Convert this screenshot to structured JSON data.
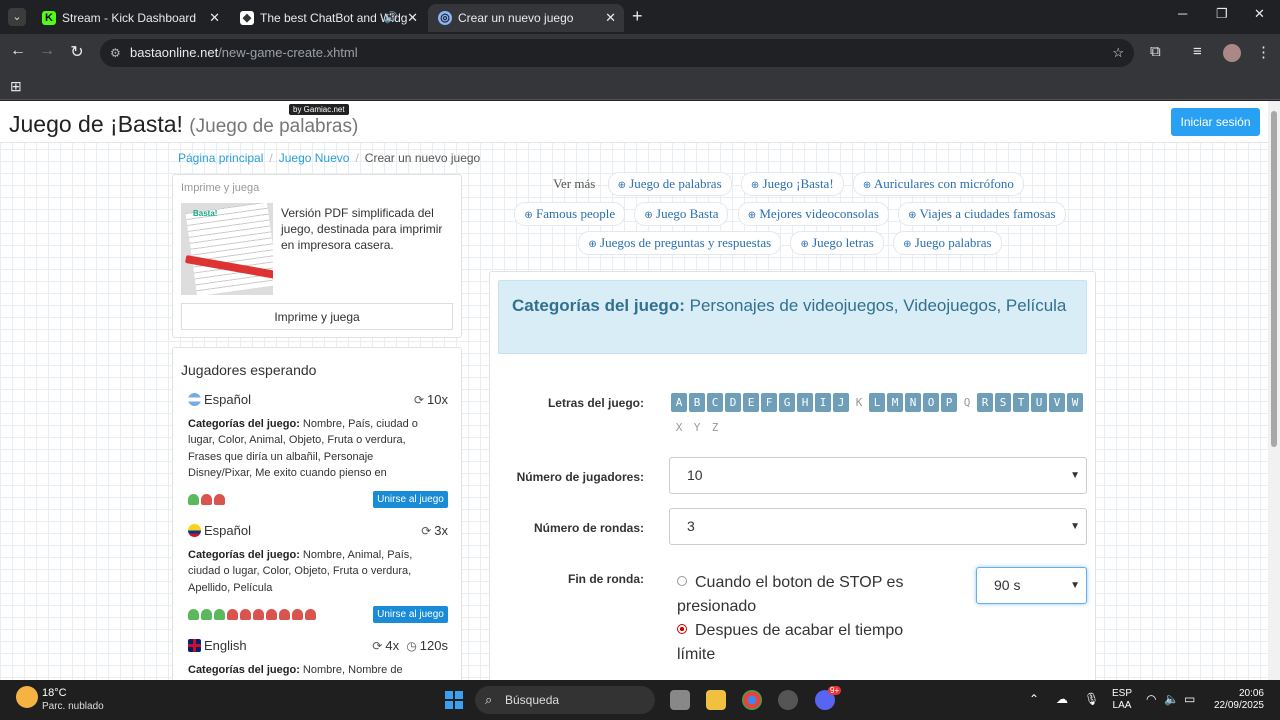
{
  "browser": {
    "tabs": [
      {
        "title": "Stream - Kick Dashboard",
        "icon": "kick-icon",
        "active": false
      },
      {
        "title": "The best ChatBot and Widg",
        "icon": "botrix-icon",
        "active": false
      },
      {
        "title": "Crear un nuevo juego",
        "icon": "globe-icon",
        "active": true
      }
    ],
    "url_host": "bastaonline.net",
    "url_path": "/new-game-create.xhtml"
  },
  "header": {
    "title": "Juego de ¡Basta!",
    "subtitle": "(Juego de palabras)",
    "badge": "by Gamiac.net",
    "login": "Iniciar sesión"
  },
  "breadcrumb": {
    "home": "Página principal",
    "new_game": "Juego Nuevo",
    "current": "Crear un nuevo juego"
  },
  "print": {
    "title": "Imprime y juega",
    "description": "Versión PDF simplificada del juego, destinada para imprimir en impresora casera.",
    "button": "Imprime y juega",
    "image_logo": "Basta!"
  },
  "players": {
    "title": "Jugadores esperando",
    "rooms": [
      {
        "language": "Español",
        "rounds": "10x",
        "categories_label": "Categorías del juego:",
        "categories": "Nombre, País, ciudad o lugar, Color, Animal, Objeto, Fruta o verdura, Frases que diría un albañil, Personaje Disney/Pixar, Me exito cuando pienso en",
        "join": "Unirse al juego"
      },
      {
        "language": "Español",
        "rounds": "3x",
        "categories_label": "Categorías del juego:",
        "categories": "Nombre, Animal, País, ciudad o lugar, Color, Objeto, Fruta o verdura, Apellido, Película",
        "join": "Unirse al juego"
      },
      {
        "language": "English",
        "rounds": "4x",
        "time": "120s",
        "categories_label": "Categorías del juego:",
        "categories": "Nombre, Nombre de"
      }
    ]
  },
  "tags": {
    "more": "Ver más",
    "row1": [
      "Juego de palabras",
      "Juego ¡Basta!",
      "Auriculares con micrófono"
    ],
    "row2": [
      "Famous people",
      "Juego Basta",
      "Mejores videoconsolas",
      "Viajes a ciudades famosas"
    ],
    "row3": [
      "Juegos de preguntas y respuestas",
      "Juego letras",
      "Juego palabras"
    ]
  },
  "game": {
    "categories_label": "Categorías del juego:",
    "categories": "Personajes de videojuegos, Videojuegos, Película",
    "letters_label": "Letras del juego:",
    "letters_active": [
      "A",
      "B",
      "C",
      "D",
      "E",
      "F",
      "G",
      "H",
      "I",
      "J",
      "L",
      "M",
      "N",
      "O",
      "P",
      "R",
      "S",
      "T",
      "U",
      "V",
      "W"
    ],
    "letters_inactive": [
      "K",
      "Q",
      "X",
      "Y",
      "Z"
    ],
    "players_label": "Número de jugadores:",
    "players_value": "10",
    "rounds_label": "Número de rondas:",
    "rounds_value": "3",
    "end_label": "Fin de ronda:",
    "end_option_1": "Cuando el boton de STOP es presionado",
    "end_option_2": "Despues de acabar el tiempo límite",
    "time_value": "90 s"
  },
  "taskbar": {
    "temp": "18°C",
    "weather": "Parc. nublado",
    "search": "Búsqueda",
    "lang_1": "ESP",
    "lang_2": "LAA",
    "time": "20:06",
    "date": "22/09/2025",
    "discord_badge": "9+"
  },
  "colors": {
    "accent": "#29a1f2",
    "link": "#2a9fd8",
    "info_bg": "#d9edf7",
    "info_text": "#31708f",
    "letter_on": "#6f9fb8",
    "pawn_green": "#5cb85c",
    "pawn_red": "#d9534f"
  }
}
